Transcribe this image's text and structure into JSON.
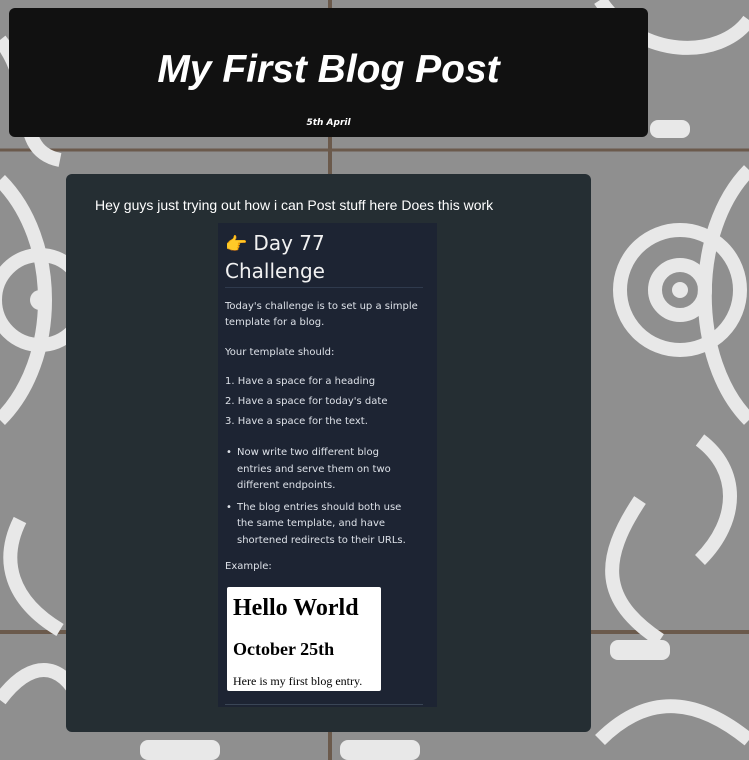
{
  "post": {
    "title": "My First Blog Post",
    "date": "5th April",
    "body": "Hey guys just trying out how i can Post stuff here Does this work"
  },
  "screenshot": {
    "heading_line1": "Day 77",
    "heading_line2": "Challenge",
    "icon": "pointing-hand-icon",
    "intro": "Today's challenge is to set up a simple template for a blog.",
    "template_should": "Your template should:",
    "numbered": [
      "1. Have a space for a heading",
      "2. Have a space for today's date",
      "3. Have a space for the text."
    ],
    "bullets": [
      "Now write two different blog entries and serve them on two different endpoints.",
      "The blog entries should both use the same template, and have shortened redirects to their URLs."
    ],
    "example_label": "Example:",
    "example": {
      "heading": "Hello World",
      "date": "October 25th",
      "text": "Here is my first blog entry."
    }
  },
  "colors": {
    "header_bg": "#111111",
    "card_bg": "#252e33",
    "screenshot_bg": "#1d2433"
  }
}
